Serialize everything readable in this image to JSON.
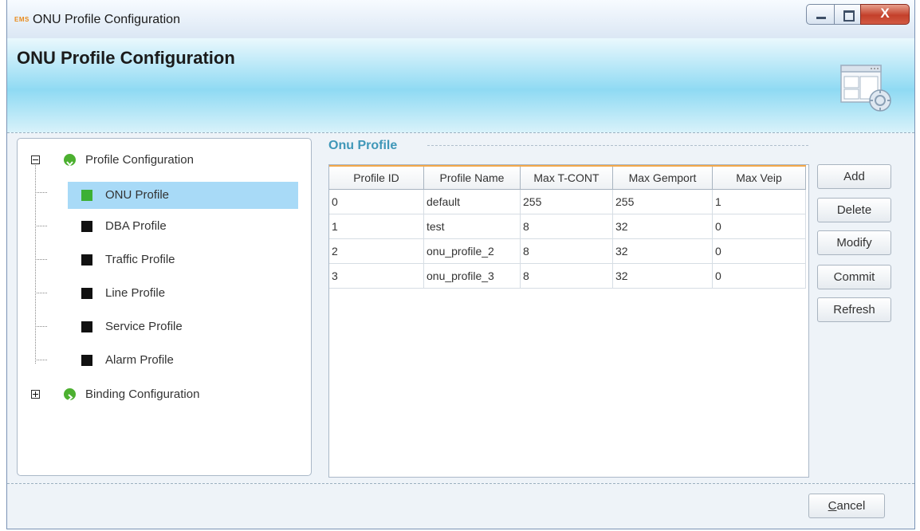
{
  "window": {
    "app_icon_text": "EMS",
    "title": "ONU Profile Configuration",
    "controls": {
      "minimize": "minimize",
      "maximize": "maximize",
      "close": "X"
    }
  },
  "header": {
    "title": "ONU Profile Configuration",
    "icon": "config-window-icon"
  },
  "tree": {
    "groups": [
      {
        "label": "Profile Configuration",
        "expanded": true,
        "items": [
          {
            "label": "ONU Profile",
            "selected": true,
            "color": "#3cb034"
          },
          {
            "label": "DBA Profile",
            "color": "#111111"
          },
          {
            "label": "Traffic Profile",
            "color": "#111111"
          },
          {
            "label": "Line Profile",
            "color": "#111111"
          },
          {
            "label": "Service Profile",
            "color": "#111111"
          },
          {
            "label": "Alarm Profile",
            "color": "#111111"
          }
        ]
      },
      {
        "label": "Binding Configuration",
        "expanded": false
      }
    ]
  },
  "content": {
    "group_title": "Onu Profile",
    "table": {
      "columns": [
        "Profile ID",
        "Profile Name",
        "Max T-CONT",
        "Max Gemport",
        "Max Veip"
      ],
      "rows": [
        [
          "0",
          "default",
          "255",
          "255",
          "1"
        ],
        [
          "1",
          "test",
          "8",
          "32",
          "0"
        ],
        [
          "2",
          "onu_profile_2",
          "8",
          "32",
          "0"
        ],
        [
          "3",
          "onu_profile_3",
          "8",
          "32",
          "0"
        ]
      ]
    },
    "actions": {
      "add": "Add",
      "delete": "Delete",
      "modify": "Modify",
      "commit": "Commit",
      "refresh": "Refresh"
    }
  },
  "footer": {
    "cancel_label": "Cancel"
  },
  "colors": {
    "accent": "#3f97b8",
    "selection": "#a8daf7",
    "header_top": "#eaf8fd",
    "header_mid": "#8fdaf3"
  }
}
